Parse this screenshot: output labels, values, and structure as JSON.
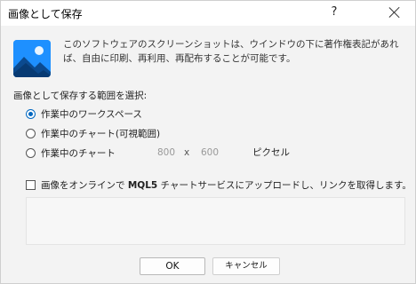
{
  "window": {
    "title": "画像として保存",
    "help_label": "?"
  },
  "info": {
    "text": "このソフトウェアのスクリーンショットは、ウインドウの下に著作権表記があれば、自由に印刷、再利用、再配布することが可能です。"
  },
  "section": {
    "label": "画像として保存する範囲を選択:"
  },
  "options": [
    {
      "label": "作業中のワークスペース",
      "selected": true
    },
    {
      "label": "作業中のチャート(可視範囲)",
      "selected": false
    },
    {
      "label": "作業中のチャート",
      "selected": false
    }
  ],
  "size": {
    "width_value": "800",
    "times_label": "x",
    "height_value": "600",
    "unit_label": "ピクセル"
  },
  "upload": {
    "prefix": "画像をオンラインで ",
    "brand": "MQL5",
    "suffix": " チャートサービスにアップロードし、リンクを取得します。",
    "checked": false
  },
  "buttons": {
    "ok_label": "OK",
    "cancel_label": "キャンセル"
  },
  "colors": {
    "accent": "#0067c0",
    "icon_bg": "#1e90ff"
  },
  "icons": {
    "app": "image-icon",
    "close": "close-icon"
  }
}
